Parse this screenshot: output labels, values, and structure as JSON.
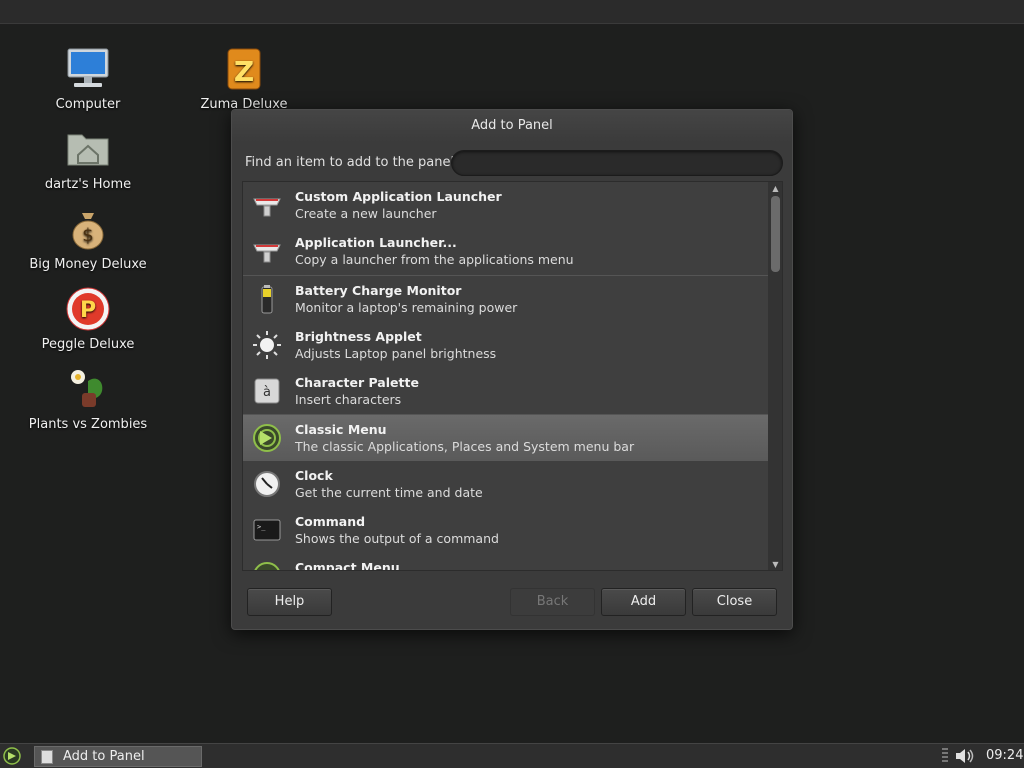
{
  "desktop": {
    "icons": [
      {
        "label": "Computer"
      },
      {
        "label": "dartz's Home"
      },
      {
        "label": "Big Money Deluxe"
      },
      {
        "label": "Peggle Deluxe"
      },
      {
        "label": "Plants vs Zombies"
      },
      {
        "label": "Zuma Deluxe"
      }
    ]
  },
  "dialog": {
    "title": "Add to Panel",
    "find_label": "Find an item to add to the panel:",
    "find_value": "",
    "items": [
      {
        "title": "Custom Application Launcher",
        "desc": "Create a new launcher",
        "icon": "launcher-icon"
      },
      {
        "title": "Application Launcher...",
        "desc": "Copy a launcher from the applications menu",
        "icon": "launcher-icon"
      },
      {
        "title": "Battery Charge Monitor",
        "desc": "Monitor a laptop's remaining power",
        "icon": "battery-icon"
      },
      {
        "title": "Brightness Applet",
        "desc": "Adjusts Laptop panel brightness",
        "icon": "sun-icon"
      },
      {
        "title": "Character Palette",
        "desc": "Insert characters",
        "icon": "character-icon"
      },
      {
        "title": "Classic Menu",
        "desc": "The classic Applications, Places and System menu bar",
        "icon": "menu-icon",
        "selected": true
      },
      {
        "title": "Clock",
        "desc": "Get the current time and date",
        "icon": "clock-icon"
      },
      {
        "title": "Command",
        "desc": "Shows the output of a command",
        "icon": "terminal-icon"
      },
      {
        "title": "Compact Menu",
        "desc": "",
        "icon": "menu-icon"
      }
    ],
    "buttons": {
      "help": "Help",
      "back": "Back",
      "add": "Add",
      "close": "Close"
    }
  },
  "taskbar": {
    "task_label": "Add to Panel",
    "clock": "09:24"
  },
  "colors": {
    "selection": "#626262",
    "background": "#1e1f1e",
    "dialog": "#3b3b3b"
  }
}
